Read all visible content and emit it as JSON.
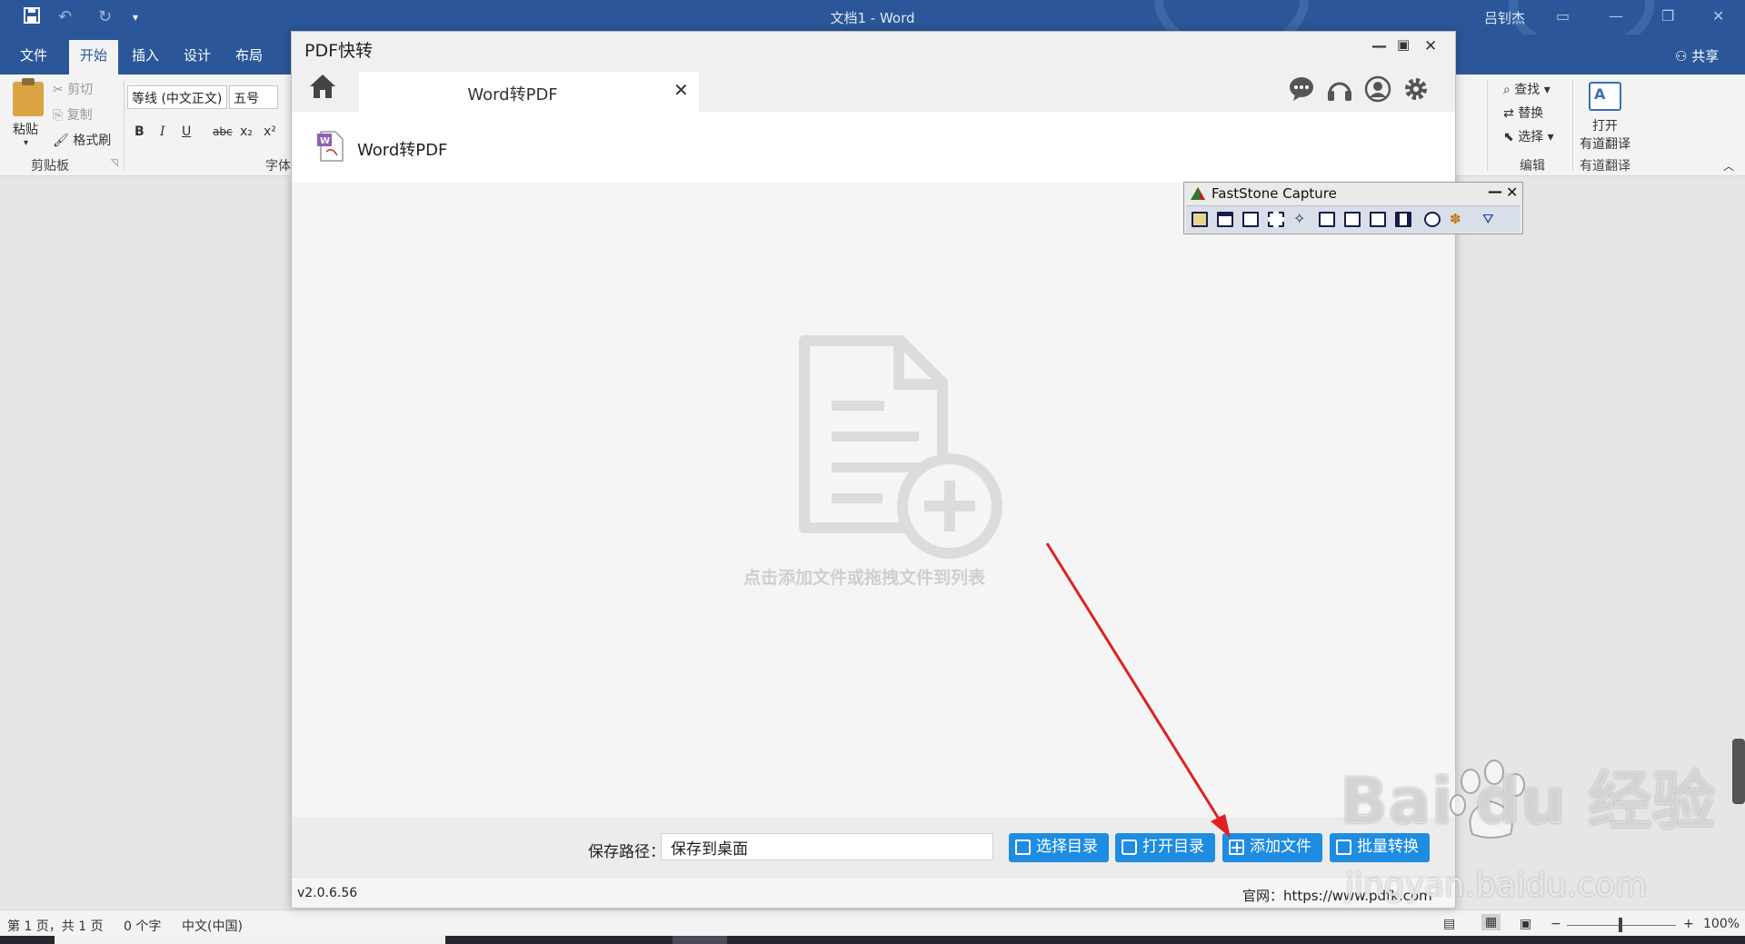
{
  "word": {
    "title": "文档1  -  Word",
    "user": "吕钊杰",
    "tabs": [
      "文件",
      "开始",
      "插入",
      "设计",
      "布局"
    ],
    "share": "共享",
    "clipboard": {
      "paste": "粘贴",
      "cut": "剪切",
      "copy": "复制",
      "format_painter": "格式刷",
      "label": "剪贴板"
    },
    "font": {
      "name": "等线 (中文正文)",
      "size": "五号",
      "label": "字体",
      "bold": "B",
      "italic": "I",
      "underline": "U",
      "strike": "abc",
      "sub": "x₂",
      "sup": "x²"
    },
    "editing": {
      "find": "查找",
      "replace": "替换",
      "select": "选择",
      "label": "编辑"
    },
    "translate": {
      "open": "打开",
      "youdao": "有道翻译",
      "label": "有道翻译"
    },
    "status": {
      "page": "第 1 页，共 1 页",
      "words": "0 个字",
      "lang": "中文(中国)",
      "zoom": "100%"
    }
  },
  "pdf": {
    "title": "PDF快转",
    "tab_label": "Word转PDF",
    "crumb": "Word转PDF",
    "drop_hint": "点击添加文件或拖拽文件到列表",
    "save_path_label": "保存路径：",
    "save_path_value": "保存到桌面",
    "buttons": {
      "select_dir": "选择目录",
      "open_dir": "打开目录",
      "add_file": "添加文件",
      "batch": "批量转换"
    },
    "version": "v2.0.6.56",
    "website": "官网：https://www.pdfk.com"
  },
  "faststone": {
    "title": "FastStone Capture"
  },
  "watermark": {
    "brand": "Bai  du 经验",
    "url": "jingyan.baidu.com"
  },
  "colors": {
    "word_blue": "#2b579a",
    "button_blue": "#1e8ce0",
    "arrow_red": "#e02020"
  }
}
